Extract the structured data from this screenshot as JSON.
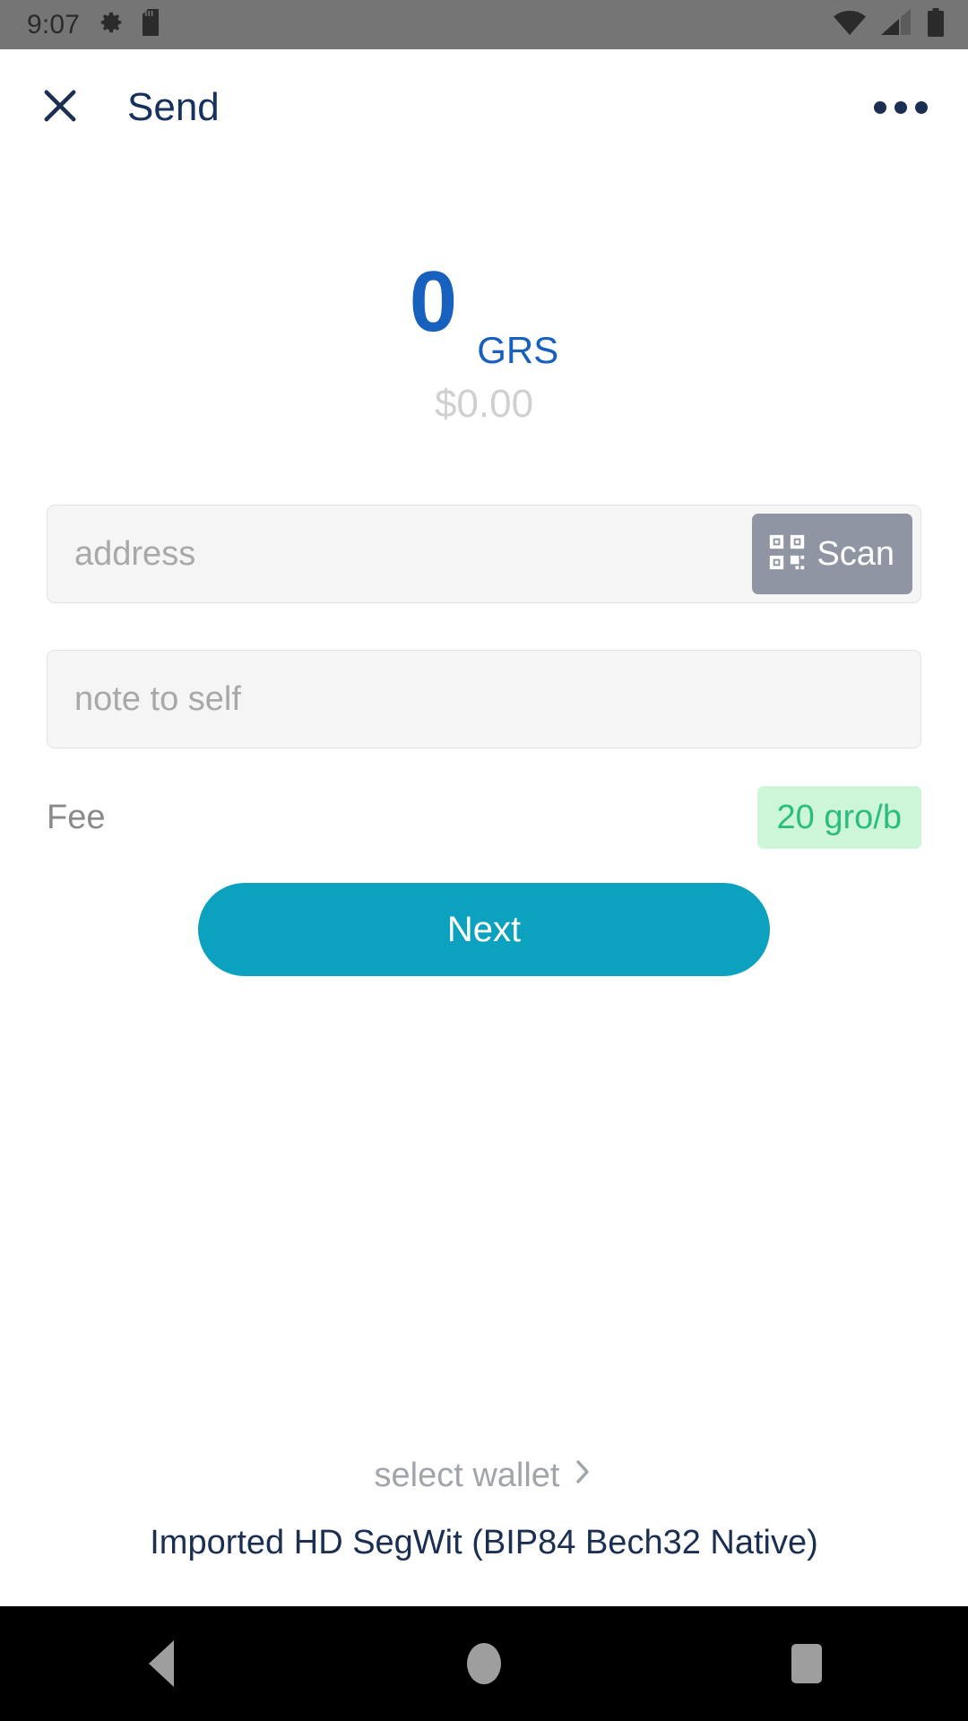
{
  "status_bar": {
    "time": "9:07",
    "icons": [
      "gear-icon",
      "sd-card-icon",
      "wifi-icon",
      "cellular-signal-icon",
      "battery-icon"
    ]
  },
  "app_bar": {
    "close_label": "close-icon",
    "title": "Send",
    "overflow_label": "more-options-icon"
  },
  "amount": {
    "value": "0",
    "unit": "GRS",
    "fiat": "$0.00"
  },
  "form": {
    "address_placeholder": "address",
    "scan_label": "Scan",
    "note_placeholder": "note to self"
  },
  "fee": {
    "label": "Fee",
    "value": "20 gro/b"
  },
  "actions": {
    "next_label": "Next"
  },
  "wallet": {
    "select_label": "select wallet",
    "chevron": "›",
    "name": "Imported HD SegWit (BIP84 Bech32 Native)"
  },
  "nav_bar": {
    "back": "back-icon",
    "home": "home-icon",
    "recents": "recents-icon"
  },
  "colors": {
    "accent_blue": "#1760be",
    "accent_cyan": "#0ca1bf",
    "navy": "#1a2f52",
    "fee_green_text": "#2bbd7e",
    "fee_green_bg": "#cdf5d8",
    "scan_gray": "#9095a3"
  }
}
